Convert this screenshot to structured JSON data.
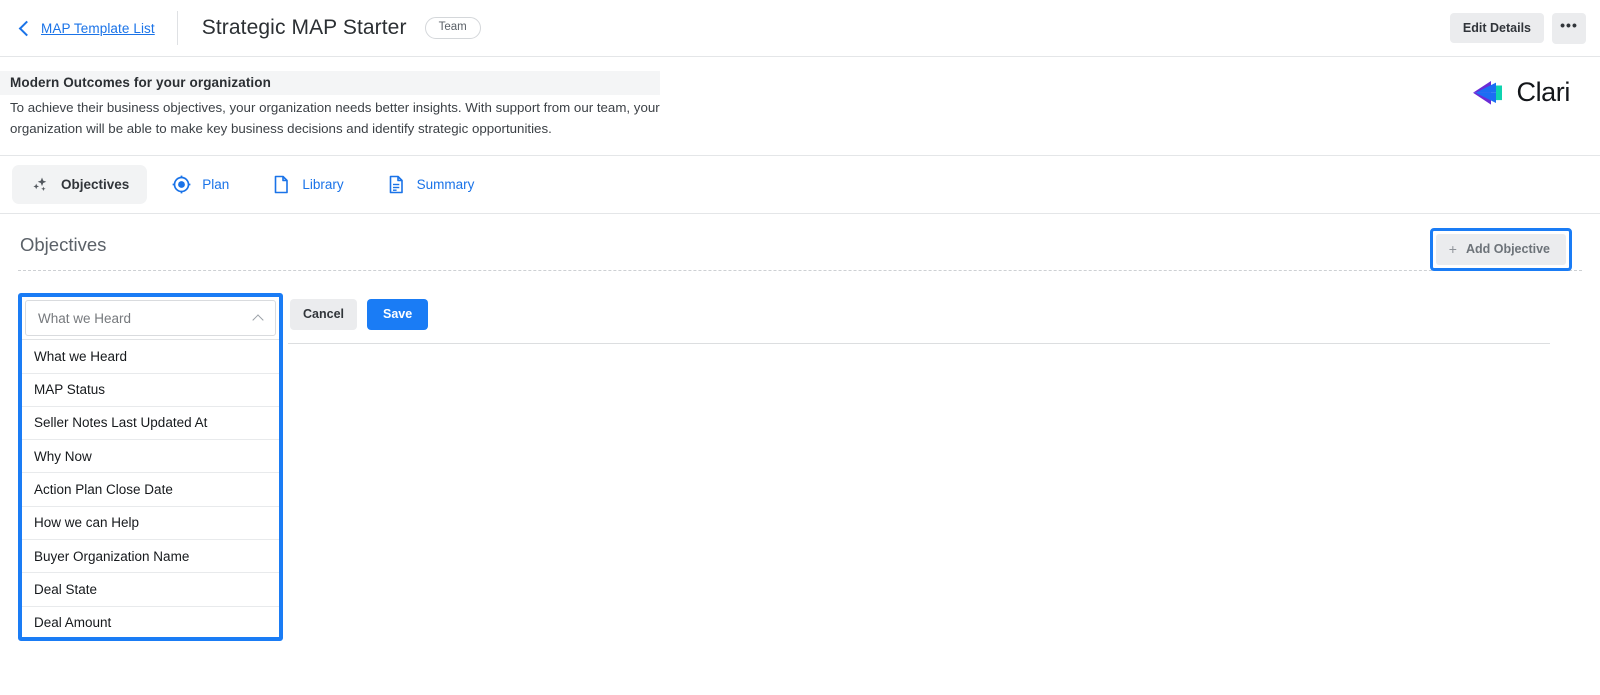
{
  "topbar": {
    "back_link": "MAP Template List",
    "back_icon": "chevron-left-icon",
    "title": "Strategic MAP Starter",
    "badge": "Team",
    "edit_details_label": "Edit Details",
    "more_label": "•••"
  },
  "description": {
    "heading": "Modern Outcomes for your organization",
    "body": "To achieve their business objectives, your organization needs better insights. With support from our team, your organization will be able to make key business decisions and identify strategic opportunities."
  },
  "brand": {
    "name": "Clari",
    "mark_icon": "clari-arrow-mark",
    "color_purple": "#6B2BD6",
    "color_blue": "#1B6EF3",
    "color_teal": "#0FD3B0"
  },
  "tabs": [
    {
      "label": "Objectives",
      "icon": "sparkles-icon",
      "active": true
    },
    {
      "label": "Plan",
      "icon": "target-icon",
      "active": false
    },
    {
      "label": "Library",
      "icon": "document-icon",
      "active": false
    },
    {
      "label": "Summary",
      "icon": "document-lines-icon",
      "active": false
    }
  ],
  "objectives": {
    "section_title": "Objectives",
    "add_button_label": "Add Objective",
    "add_button_icon": "plus-icon",
    "highlight_color": "#1A7CF5"
  },
  "form": {
    "select": {
      "value": "What we Heard",
      "chevron_icon": "chevron-up-icon",
      "options": [
        "What we Heard",
        "MAP Status",
        "Seller Notes Last Updated At",
        "Why Now",
        "Action Plan Close Date",
        "How we can Help",
        "Buyer Organization Name",
        "Deal State",
        "Deal Amount"
      ]
    },
    "cancel_label": "Cancel",
    "save_label": "Save"
  }
}
